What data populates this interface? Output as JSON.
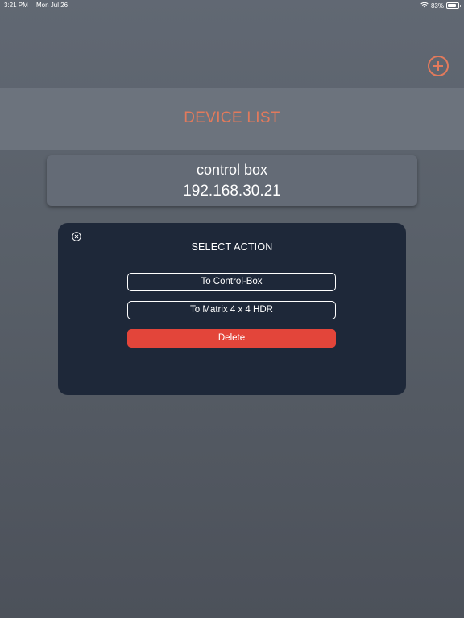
{
  "status_bar": {
    "time": "3:21 PM",
    "date": "Mon Jul 26",
    "battery_percent": "83%",
    "battery_level": 0.83,
    "wifi_icon": "wifi-icon",
    "battery_icon": "battery-icon"
  },
  "header": {
    "add_icon": "plus-circle-icon",
    "title": "DEVICE LIST"
  },
  "devices": [
    {
      "name": "control box",
      "ip": "192.168.30.21"
    }
  ],
  "modal": {
    "close_icon": "close-circle-icon",
    "title": "SELECT ACTION",
    "actions": [
      {
        "label": "To Control-Box"
      },
      {
        "label": "To Matrix 4 x 4 HDR"
      },
      {
        "label": "Delete"
      }
    ]
  },
  "colors": {
    "accent": "#e27a5c",
    "modal_bg": "#1e2839",
    "delete": "#e3453a"
  }
}
